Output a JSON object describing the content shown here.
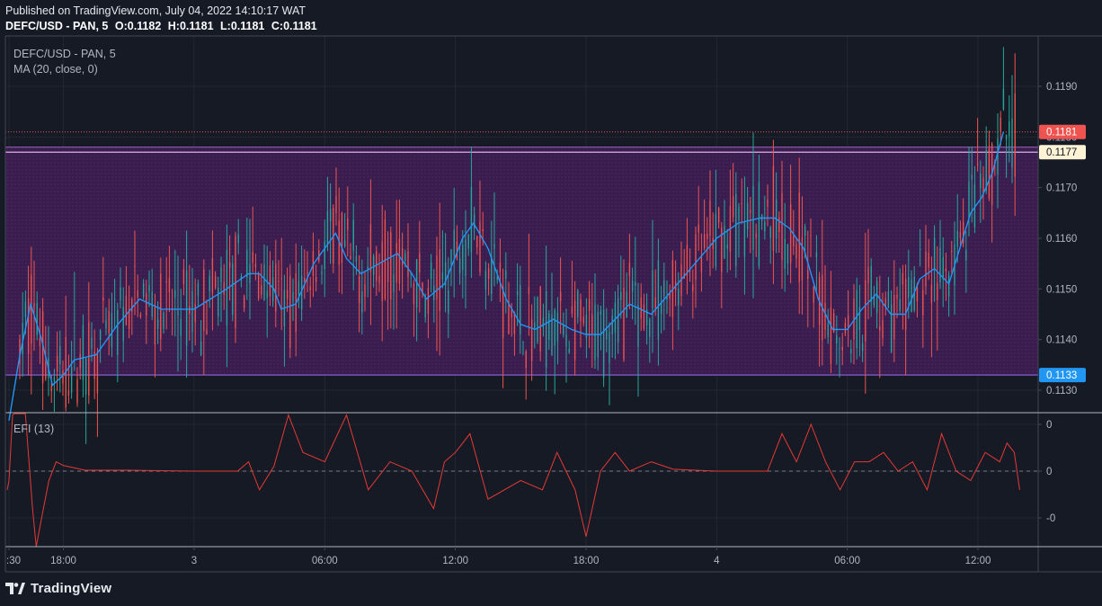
{
  "header": {
    "published": "Published on TradingView.com, July 04, 2022 14:10:17 WAT",
    "symbol": "DEFC/USD - PAN, 5",
    "o_label": "O:",
    "o_value": "0.1182",
    "h_label": "H:",
    "h_value": "0.1181",
    "l_label": "L:",
    "l_value": "0.1181",
    "c_label": "C:",
    "c_value": "0.1181"
  },
  "legend": {
    "symbol": "DEFC/USD - PAN, 5",
    "ma": "MA (20, close, 0)",
    "efi": "EFI (13)"
  },
  "footer": {
    "brand": "TradingView"
  },
  "colors": {
    "background": "#161a25",
    "up": "#26a69a",
    "down": "#ef5350",
    "ma": "#2196f3",
    "zone_fill": "#3d1f52",
    "resistance": "#d8b4e2",
    "support": "#7e57c2",
    "efi": "#e53935",
    "price_badge": "#ef5350",
    "support_badge": "#2196f3",
    "resistance_badge": "#fff3d6"
  },
  "chart_data": [
    {
      "type": "candlestick",
      "title": "DEFC/USD - PAN, 5",
      "ylim": [
        0.1126,
        0.1201
      ],
      "y_ticks": [
        "0.1130",
        "0.1140",
        "0.1150",
        "0.1160",
        "0.1170",
        "0.1180",
        "0.1190"
      ],
      "y_tick_values": [
        0.113,
        0.114,
        0.115,
        0.116,
        0.117,
        0.118,
        0.119
      ],
      "x_ticks": [
        ":30",
        "18:00",
        "3",
        "06:00",
        "12:00",
        "18:00",
        "4",
        "06:00",
        "12:00"
      ],
      "x_tick_times": [
        "2022-07-02 15:30",
        "2022-07-02 18:00",
        "2022-07-03 00:00",
        "2022-07-03 06:00",
        "2022-07-03 12:00",
        "2022-07-03 18:00",
        "2022-07-04 00:00",
        "2022-07-04 06:00",
        "2022-07-04 12:00"
      ],
      "current_price": 0.1181,
      "current_price_label": "0.1181",
      "resistance_level": 0.1177,
      "resistance_label": "0.1177",
      "support_level": 0.1133,
      "support_label": "0.1133",
      "zone": [
        0.1133,
        0.1178
      ],
      "ma_series": {
        "name": "MA (20, close, 0)",
        "points": [
          [
            "2022-07-02 15:30",
            0.1124
          ],
          [
            "2022-07-02 16:00",
            0.1137
          ],
          [
            "2022-07-02 16:30",
            0.1147
          ],
          [
            "2022-07-02 17:00",
            0.114
          ],
          [
            "2022-07-02 17:30",
            0.1131
          ],
          [
            "2022-07-02 18:00",
            0.1133
          ],
          [
            "2022-07-02 18:30",
            0.1136
          ],
          [
            "2022-07-02 19:30",
            0.1137
          ],
          [
            "2022-07-02 20:30",
            0.1143
          ],
          [
            "2022-07-02 21:30",
            0.1148
          ],
          [
            "2022-07-02 22:30",
            0.1146
          ],
          [
            "2022-07-03 00:00",
            0.1146
          ],
          [
            "2022-07-03 01:30",
            0.115
          ],
          [
            "2022-07-03 02:30",
            0.1153
          ],
          [
            "2022-07-03 03:00",
            0.1153
          ],
          [
            "2022-07-03 03:40",
            0.115
          ],
          [
            "2022-07-03 04:00",
            0.1146
          ],
          [
            "2022-07-03 04:40",
            0.1147
          ],
          [
            "2022-07-03 05:30",
            0.1155
          ],
          [
            "2022-07-03 06:30",
            0.1161
          ],
          [
            "2022-07-03 07:00",
            0.1156
          ],
          [
            "2022-07-03 07:40",
            0.1153
          ],
          [
            "2022-07-03 08:30",
            0.1155
          ],
          [
            "2022-07-03 09:20",
            0.1157
          ],
          [
            "2022-07-03 10:00",
            0.1153
          ],
          [
            "2022-07-03 10:40",
            0.1148
          ],
          [
            "2022-07-03 11:30",
            0.1151
          ],
          [
            "2022-07-03 12:20",
            0.116
          ],
          [
            "2022-07-03 12:50",
            0.1163
          ],
          [
            "2022-07-03 13:30",
            0.1158
          ],
          [
            "2022-07-03 14:20",
            0.1148
          ],
          [
            "2022-07-03 15:00",
            0.1143
          ],
          [
            "2022-07-03 15:40",
            0.1142
          ],
          [
            "2022-07-03 16:30",
            0.1144
          ],
          [
            "2022-07-03 17:20",
            0.1142
          ],
          [
            "2022-07-03 18:00",
            0.1141
          ],
          [
            "2022-07-03 18:40",
            0.1141
          ],
          [
            "2022-07-03 19:20",
            0.1144
          ],
          [
            "2022-07-03 20:00",
            0.1147
          ],
          [
            "2022-07-03 21:00",
            0.1145
          ],
          [
            "2022-07-03 22:00",
            0.115
          ],
          [
            "2022-07-03 23:00",
            0.1155
          ],
          [
            "2022-07-04 00:00",
            0.116
          ],
          [
            "2022-07-04 01:00",
            0.1163
          ],
          [
            "2022-07-04 02:00",
            0.1164
          ],
          [
            "2022-07-04 02:40",
            0.1164
          ],
          [
            "2022-07-04 03:20",
            0.1162
          ],
          [
            "2022-07-04 04:00",
            0.1158
          ],
          [
            "2022-07-04 04:40",
            0.1148
          ],
          [
            "2022-07-04 05:20",
            0.1142
          ],
          [
            "2022-07-04 06:00",
            0.1142
          ],
          [
            "2022-07-04 06:40",
            0.1146
          ],
          [
            "2022-07-04 07:20",
            0.1149
          ],
          [
            "2022-07-04 08:00",
            0.1145
          ],
          [
            "2022-07-04 08:40",
            0.1145
          ],
          [
            "2022-07-04 09:20",
            0.1152
          ],
          [
            "2022-07-04 10:00",
            0.1154
          ],
          [
            "2022-07-04 10:40",
            0.1151
          ],
          [
            "2022-07-04 11:10",
            0.1158
          ],
          [
            "2022-07-04 11:40",
            0.1165
          ],
          [
            "2022-07-04 12:10",
            0.1168
          ],
          [
            "2022-07-04 12:40",
            0.1173
          ],
          [
            "2022-07-04 13:10",
            0.1181
          ]
        ]
      }
    },
    {
      "type": "line",
      "title": "EFI (13)",
      "ylim": [
        -0.016,
        0.009
      ],
      "y_ticks": [
        "0",
        "0",
        "-0"
      ],
      "y_tick_values": [
        0.005,
        0.0,
        -0.005
      ],
      "zero_line": 0,
      "series": [
        {
          "name": "EFI (13)",
          "points": [
            [
              "2022-07-02 15:25",
              -0.002
            ],
            [
              "2022-07-02 15:30",
              -0.001
            ],
            [
              "2022-07-02 15:40",
              0.006
            ],
            [
              "2022-07-02 15:45",
              0.009
            ],
            [
              "2022-07-02 16:00",
              0.009
            ],
            [
              "2022-07-02 16:15",
              0.008
            ],
            [
              "2022-07-02 16:35",
              -0.004
            ],
            [
              "2022-07-02 16:45",
              -0.009
            ],
            [
              "2022-07-02 17:00",
              -0.005
            ],
            [
              "2022-07-02 17:20",
              -0.001
            ],
            [
              "2022-07-02 17:40",
              0.001
            ],
            [
              "2022-07-02 18:00",
              0.0006
            ],
            [
              "2022-07-02 19:00",
              0.0001
            ],
            [
              "2022-07-02 21:00",
              0.0001
            ],
            [
              "2022-07-03 00:00",
              0.0
            ],
            [
              "2022-07-03 02:00",
              0.0
            ],
            [
              "2022-07-03 02:30",
              0.001
            ],
            [
              "2022-07-03 03:00",
              -0.002
            ],
            [
              "2022-07-03 03:40",
              0.0005
            ],
            [
              "2022-07-03 04:20",
              0.006
            ],
            [
              "2022-07-03 05:00",
              0.002
            ],
            [
              "2022-07-03 06:00",
              0.001
            ],
            [
              "2022-07-03 07:00",
              0.006
            ],
            [
              "2022-07-03 08:00",
              -0.002
            ],
            [
              "2022-07-03 09:00",
              0.001
            ],
            [
              "2022-07-03 10:00",
              0.0
            ],
            [
              "2022-07-03 11:00",
              -0.004
            ],
            [
              "2022-07-03 11:30",
              0.001
            ],
            [
              "2022-07-03 12:00",
              0.002
            ],
            [
              "2022-07-03 12:40",
              0.004
            ],
            [
              "2022-07-03 13:30",
              -0.003
            ],
            [
              "2022-07-03 15:00",
              -0.001
            ],
            [
              "2022-07-03 16:00",
              -0.002
            ],
            [
              "2022-07-03 16:40",
              0.002
            ],
            [
              "2022-07-03 17:30",
              -0.002
            ],
            [
              "2022-07-03 18:00",
              -0.007
            ],
            [
              "2022-07-03 18:40",
              0.0
            ],
            [
              "2022-07-03 19:20",
              0.002
            ],
            [
              "2022-07-03 20:00",
              0.0
            ],
            [
              "2022-07-03 21:00",
              0.001
            ],
            [
              "2022-07-03 22:00",
              0.0002
            ],
            [
              "2022-07-04 00:00",
              0.0
            ],
            [
              "2022-07-04 01:00",
              0.0
            ],
            [
              "2022-07-04 02:20",
              0.0
            ],
            [
              "2022-07-04 03:00",
              0.004
            ],
            [
              "2022-07-04 03:40",
              0.001
            ],
            [
              "2022-07-04 04:20",
              0.005
            ],
            [
              "2022-07-04 05:00",
              0.001
            ],
            [
              "2022-07-04 05:40",
              -0.002
            ],
            [
              "2022-07-04 06:20",
              0.001
            ],
            [
              "2022-07-04 07:00",
              0.001
            ],
            [
              "2022-07-04 07:40",
              0.002
            ],
            [
              "2022-07-04 08:20",
              0.0
            ],
            [
              "2022-07-04 09:00",
              0.001
            ],
            [
              "2022-07-04 09:40",
              -0.002
            ],
            [
              "2022-07-04 10:20",
              0.004
            ],
            [
              "2022-07-04 11:00",
              0.0
            ],
            [
              "2022-07-04 11:40",
              -0.001
            ],
            [
              "2022-07-04 12:20",
              0.002
            ],
            [
              "2022-07-04 13:00",
              0.001
            ],
            [
              "2022-07-04 13:20",
              0.003
            ],
            [
              "2022-07-04 13:40",
              0.002
            ],
            [
              "2022-07-04 13:55",
              -0.002
            ]
          ]
        }
      ]
    }
  ]
}
